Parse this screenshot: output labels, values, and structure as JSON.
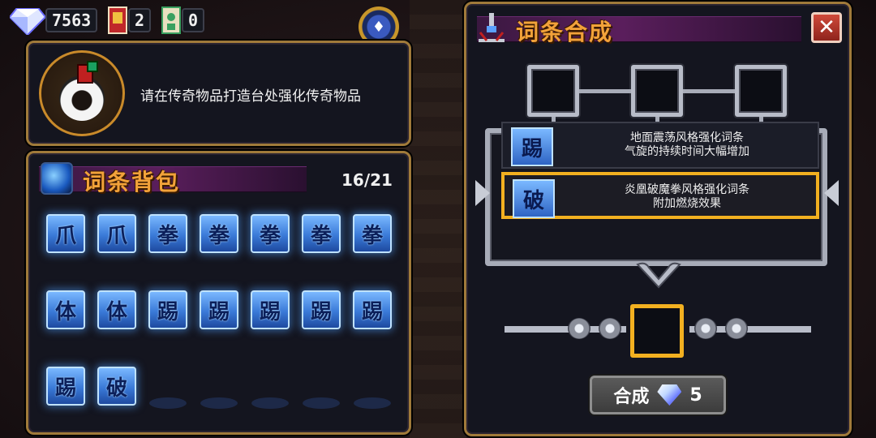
{
  "currency": {
    "gems": "7563",
    "tickets": "2",
    "cards": "0"
  },
  "legend": {
    "text": "请在传奇物品打造台处强化传奇物品"
  },
  "bag": {
    "title": "词条背包",
    "count": "16/21",
    "glyphs": [
      "爪",
      "爪",
      "拳",
      "拳",
      "拳",
      "拳",
      "拳",
      "体",
      "体",
      "踢",
      "踢",
      "踢",
      "踢",
      "踢",
      "踢",
      "破"
    ]
  },
  "synth": {
    "title": "词条合成",
    "entries": [
      {
        "icon": "踢",
        "line1": "地面震荡风格强化词条",
        "line2": "气旋的持续时间大幅增加"
      },
      {
        "icon": "破",
        "line1": "炎凰破魔拳风格强化词条",
        "line2": "附加燃烧效果"
      }
    ],
    "craft_label": "合成",
    "craft_cost": "5"
  },
  "colors": {
    "title": "#f2a23a",
    "panel_border": "#a07a3a",
    "selected": "#f2b020",
    "glyph": "#3a7ad8"
  }
}
